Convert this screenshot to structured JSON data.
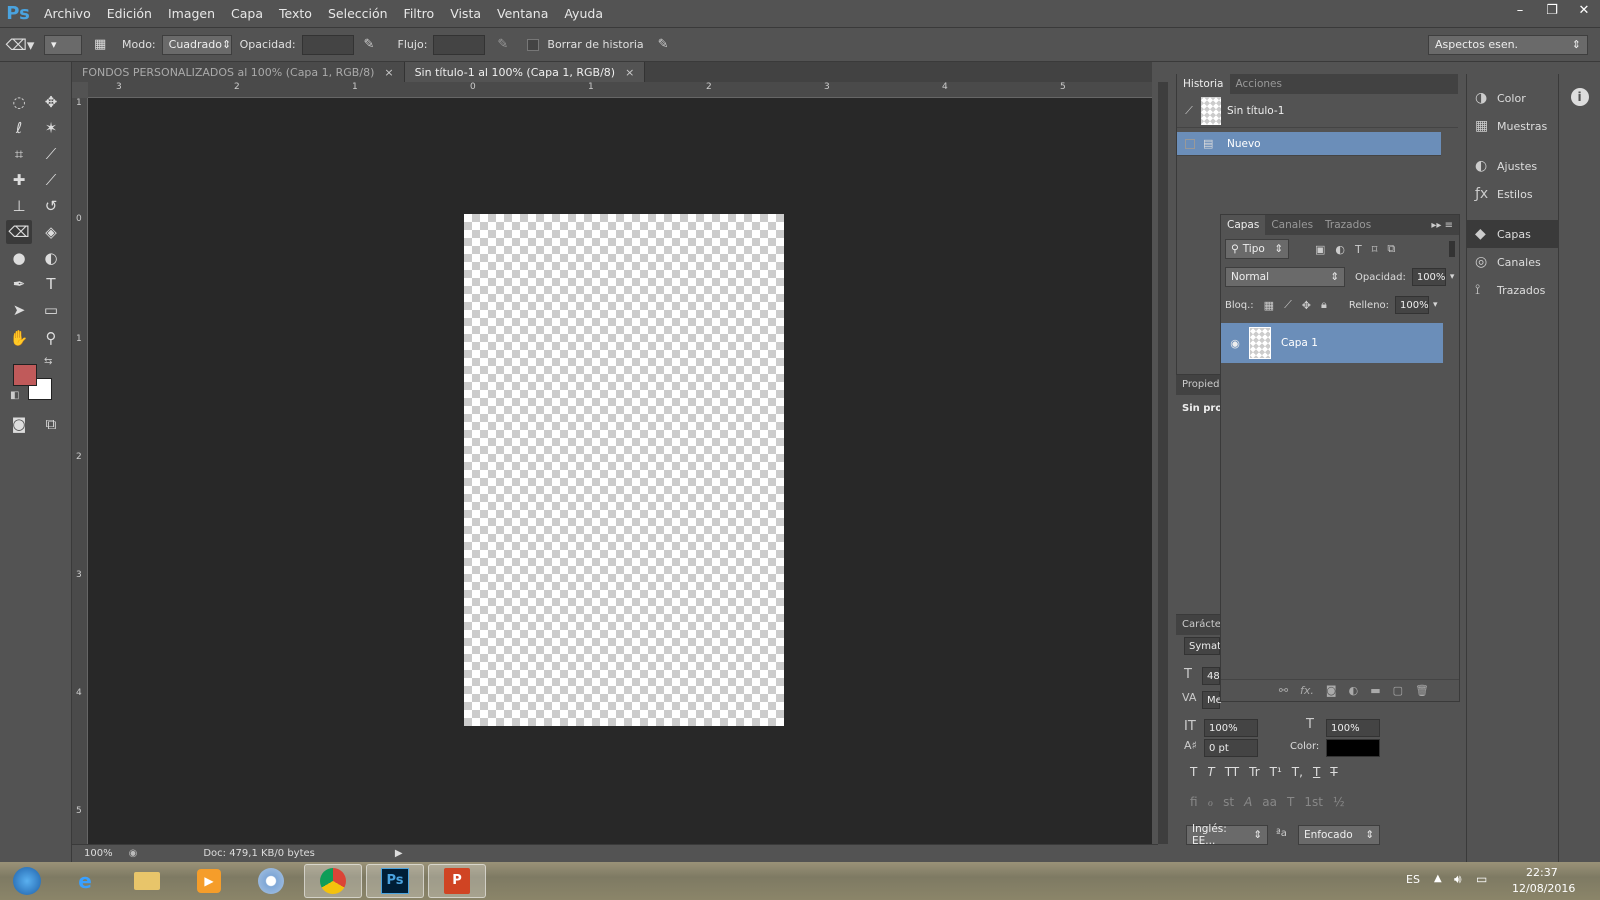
{
  "app": {
    "logo": "Ps"
  },
  "menu": [
    "Archivo",
    "Edición",
    "Imagen",
    "Capa",
    "Texto",
    "Selección",
    "Filtro",
    "Vista",
    "Ventana",
    "Ayuda"
  ],
  "window_controls": {
    "minimize": "–",
    "restore": "❐",
    "close": "✕"
  },
  "options": {
    "mode_label": "Modo:",
    "mode_value": "Cuadrado",
    "opacity_label": "Opacidad:",
    "flow_label": "Flujo:",
    "erase_history_label": "Borrar de historia",
    "workspace_value": "Aspectos esen."
  },
  "doc_tabs": [
    {
      "title": "FONDOS PERSONALIZADOS al 100% (Capa 1, RGB/8)",
      "close": "×"
    },
    {
      "title": "Sin título-1 al 100% (Capa 1, RGB/8)",
      "close": "×"
    }
  ],
  "ruler_h": [
    "3",
    "2",
    "1",
    "0",
    "1",
    "2",
    "3",
    "4",
    "5"
  ],
  "ruler_v": [
    "1",
    "0",
    "1",
    "2",
    "3",
    "4",
    "5"
  ],
  "status": {
    "zoom": "100%",
    "doc": "Doc: 479,1 KB/0 bytes"
  },
  "historia": {
    "tabs": [
      "Historia",
      "Acciones"
    ],
    "snapshot": "Sin título-1",
    "items": [
      "Nuevo"
    ]
  },
  "capas": {
    "tabs": [
      "Capas",
      "Canales",
      "Trazados"
    ],
    "filter": "Tipo",
    "blend": "Normal",
    "opacity_label": "Opacidad:",
    "opacity": "100%",
    "lock_label": "Bloq.:",
    "fill_label": "Relleno:",
    "fill": "100%",
    "layers": [
      {
        "name": "Capa 1"
      }
    ],
    "footer_fx": "fx."
  },
  "propiedades": {
    "title": "Propied",
    "text": "Sin pro"
  },
  "caracter": {
    "title": "Carácte",
    "font": "Symat",
    "size": "48",
    "kerning": "Me",
    "vscale": "100%",
    "hscale": "100%",
    "baseline": "0 pt",
    "color_label": "Color:",
    "color": "#000000",
    "language": "Inglés: EE...",
    "antialias": "Enfocado",
    "style_buttons": [
      "T",
      "T",
      "TT",
      "Tr",
      "T¹",
      "T,",
      "T",
      "T"
    ],
    "opentype_buttons": [
      "ﬁ",
      "ℴ",
      "st",
      "A",
      "aa",
      "T",
      "1st",
      "½"
    ]
  },
  "dock": [
    "Color",
    "Muestras",
    "Ajustes",
    "Estilos",
    "Capas",
    "Canales",
    "Trazados"
  ],
  "taskbar": {
    "language": "ES",
    "time": "22:37",
    "date": "12/08/2016"
  },
  "colors": {
    "foreground": "#c05a5a",
    "background": "#ffffff",
    "selection": "#6b8eb9"
  }
}
